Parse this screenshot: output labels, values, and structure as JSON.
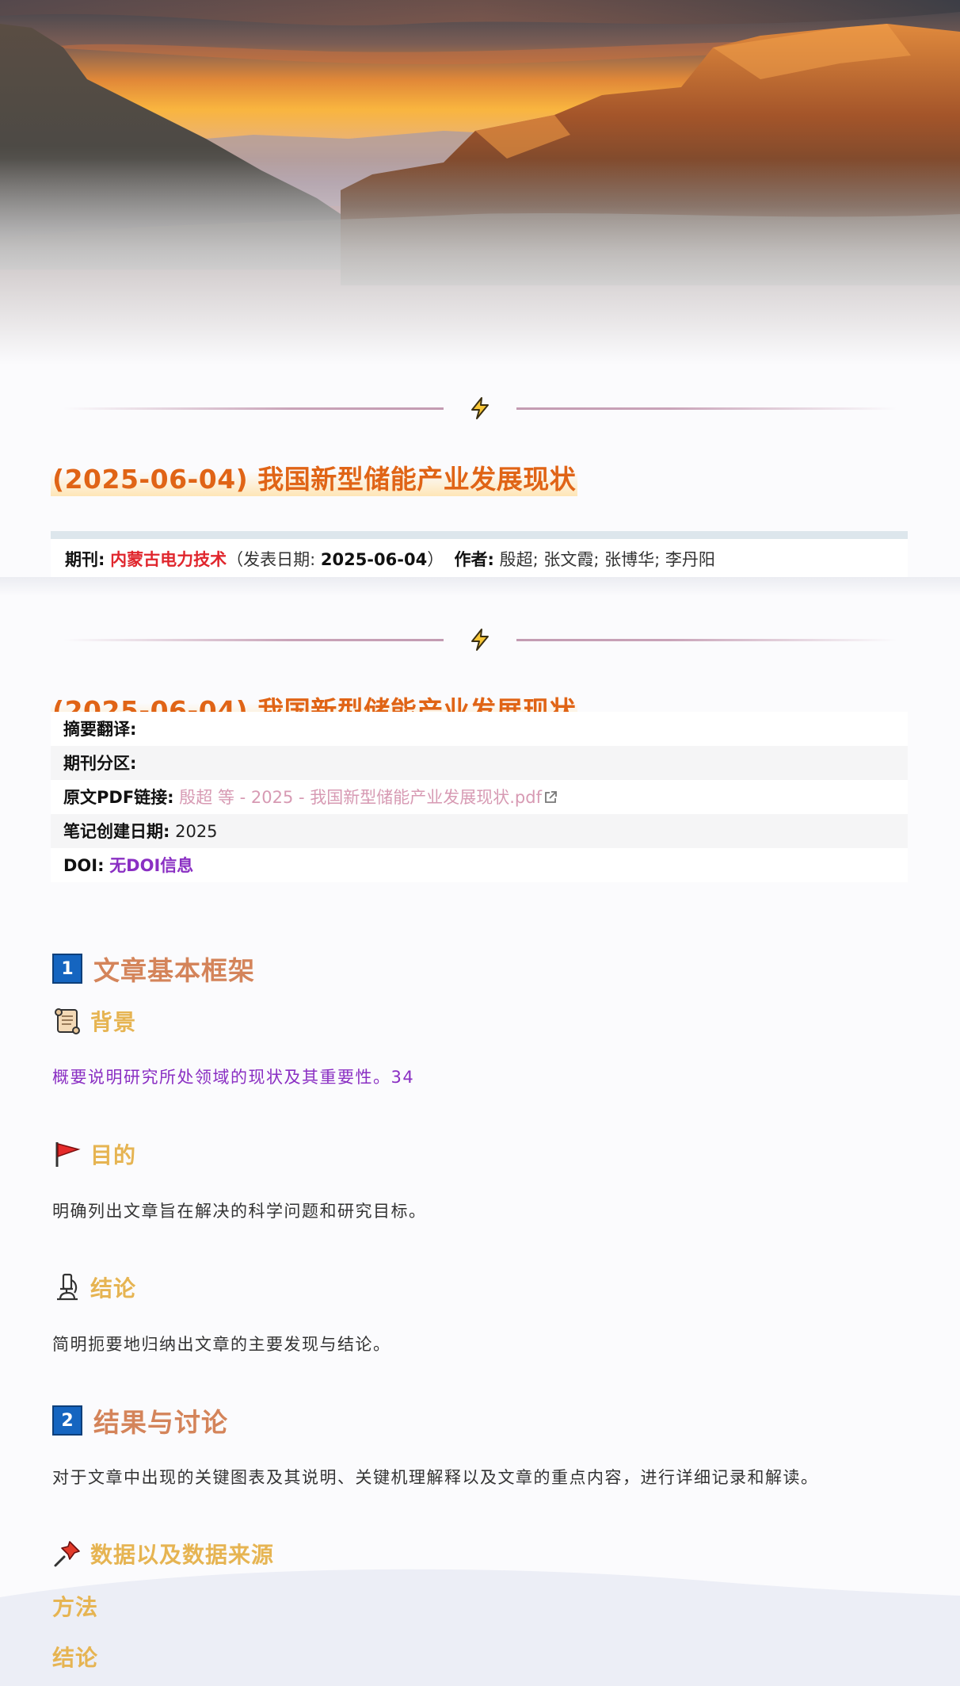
{
  "title": "(2025-06-04) 我国新型储能产业发展现状",
  "meta": {
    "journal_label": "期刊:",
    "journal": "内蒙古电力技术",
    "pubdate_open": "（发表日期:",
    "pubdate": "2025-06-04",
    "pubdate_close": "）",
    "authors_label": "作者:",
    "authors": "殷超; 张文霞; 张博华; 李丹阳"
  },
  "info": {
    "abstract_label": "摘要翻译:",
    "abstract_value": "",
    "zone_label": "期刊分区:",
    "zone_value": "",
    "pdf_label": "原文PDF链接:",
    "pdf_link": "殷超 等 - 2025 - 我国新型储能产业发展现状.pdf",
    "created_label": "笔记创建日期:",
    "created_value": "2025",
    "doi_label": "DOI:",
    "doi_value": "无DOI信息"
  },
  "section1": {
    "number": "1",
    "title": "文章基本框架",
    "background_title": "背景",
    "background_text": "概要说明研究所处领域的现状及其重要性。34",
    "purpose_title": "目的",
    "purpose_text": "明确列出文章旨在解决的科学问题和研究目标。",
    "conclusion_title": "结论",
    "conclusion_text": "简明扼要地归纳出文章的主要发现与结论。"
  },
  "section2": {
    "number": "2",
    "title": "结果与讨论",
    "intro": "对于文章中出现的关键图表及其说明、关键机理解释以及文章的重点内容，进行详细记录和解读。",
    "data_title": "数据以及数据来源",
    "method_title": "方法",
    "conclusion_title": "结论"
  },
  "icons": {
    "divider": "lightning-bolt-icon",
    "background": "scroll-icon",
    "purpose": "red-flag-icon",
    "conclusion": "microscope-icon",
    "data": "pushpin-icon",
    "pdf_link": "external-link-icon"
  },
  "colors": {
    "title": "#e06416",
    "journal": "#e0262d",
    "section_heading": "#d4845a",
    "sub_heading": "#e6b452",
    "pdf_link": "#d79ab3",
    "doi": "#8a2fc3",
    "badge": "#1565c0"
  }
}
